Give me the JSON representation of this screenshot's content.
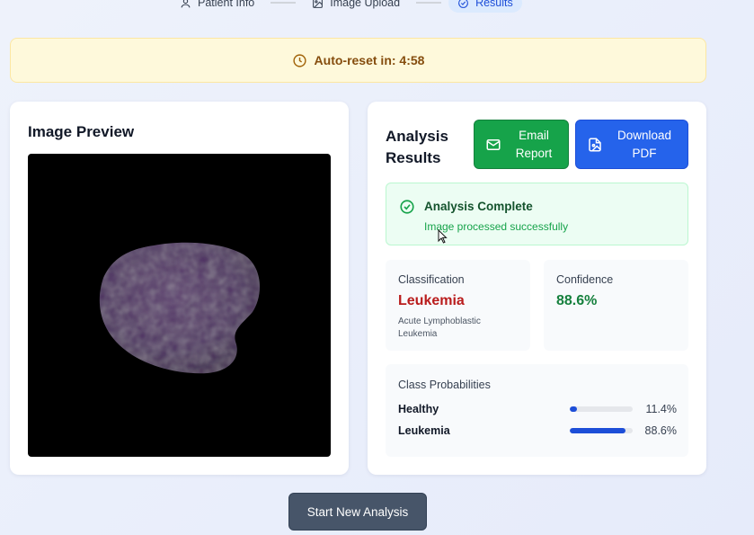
{
  "stepper": {
    "steps": [
      {
        "label": "Patient Info",
        "icon": "user-icon",
        "active": false
      },
      {
        "label": "Image Upload",
        "icon": "image-icon",
        "active": false
      },
      {
        "label": "Results",
        "icon": "check-circle-icon",
        "active": true
      }
    ]
  },
  "banner": {
    "text": "Auto-reset in: 4:58",
    "icon": "clock-icon"
  },
  "preview": {
    "title": "Image Preview"
  },
  "results": {
    "title": "Analysis Results",
    "email_button": "Email Report",
    "download_button": "Download PDF",
    "status": {
      "title": "Analysis Complete",
      "subtitle": "Image processed successfully"
    },
    "classification": {
      "label": "Classification",
      "value": "Leukemia",
      "description": "Acute Lymphoblastic Leukemia"
    },
    "confidence": {
      "label": "Confidence",
      "value": "88.6%"
    },
    "probabilities": {
      "title": "Class Probabilities",
      "items": [
        {
          "name": "Healthy",
          "percent_text": "11.4%",
          "value": 11.4
        },
        {
          "name": "Leukemia",
          "percent_text": "88.6%",
          "value": 88.6
        }
      ]
    }
  },
  "actions": {
    "new_analysis": "Start New Analysis"
  },
  "colors": {
    "email": "#16a34a",
    "download": "#2563eb",
    "leukemia": "#b91c1c",
    "confidence": "#15803d",
    "bar": "#1d4ed8",
    "banner_bg": "#fef9db"
  }
}
